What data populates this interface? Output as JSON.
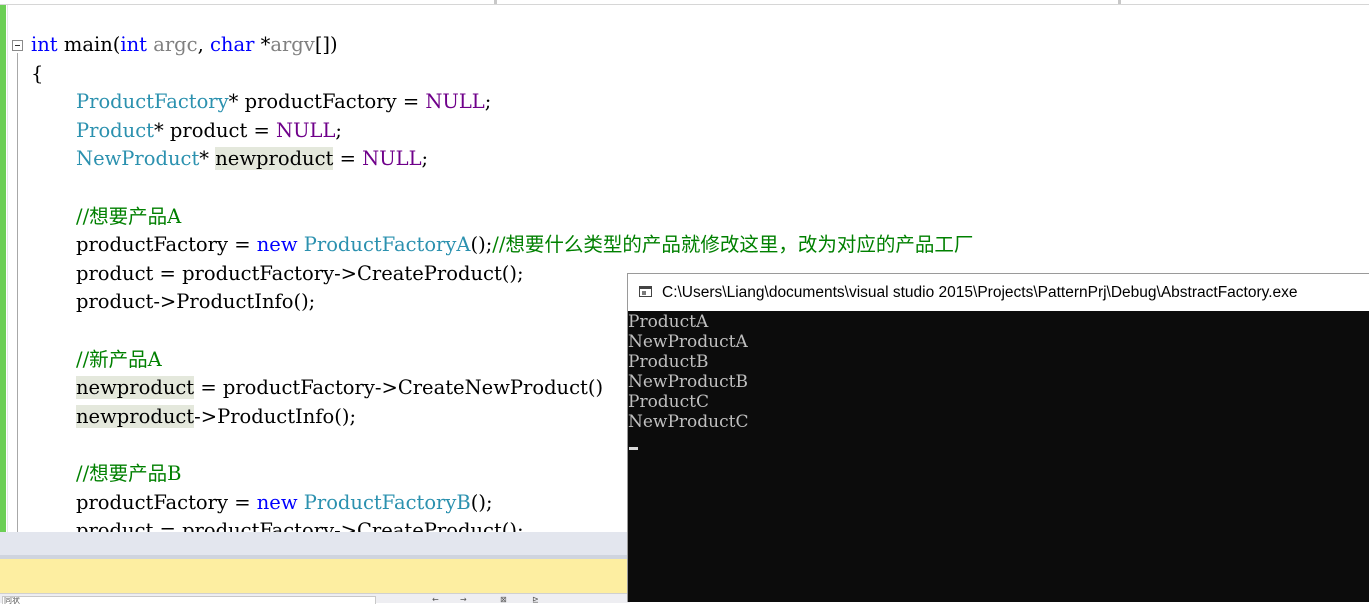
{
  "editor": {
    "lines": [
      [
        {
          "t": "int",
          "c": "kw"
        },
        {
          "t": " main(",
          "c": ""
        },
        {
          "t": "int",
          "c": "kw"
        },
        {
          "t": " ",
          "c": ""
        },
        {
          "t": "argc",
          "c": "param"
        },
        {
          "t": ", ",
          "c": ""
        },
        {
          "t": "char",
          "c": "kw"
        },
        {
          "t": " *",
          "c": ""
        },
        {
          "t": "argv",
          "c": "param"
        },
        {
          "t": "[])",
          "c": ""
        }
      ],
      [
        {
          "t": "{",
          "c": ""
        }
      ],
      [
        {
          "i": 1
        },
        {
          "t": "ProductFactory",
          "c": "type"
        },
        {
          "t": "* productFactory = ",
          "c": ""
        },
        {
          "t": "NULL",
          "c": "macro"
        },
        {
          "t": ";",
          "c": ""
        }
      ],
      [
        {
          "i": 1
        },
        {
          "t": "Product",
          "c": "type"
        },
        {
          "t": "* product = ",
          "c": ""
        },
        {
          "t": "NULL",
          "c": "macro"
        },
        {
          "t": ";",
          "c": ""
        }
      ],
      [
        {
          "i": 1
        },
        {
          "t": "NewProduct",
          "c": "type"
        },
        {
          "t": "* ",
          "c": ""
        },
        {
          "t": "newproduct",
          "c": "hl"
        },
        {
          "t": " = ",
          "c": ""
        },
        {
          "t": "NULL",
          "c": "macro"
        },
        {
          "t": ";",
          "c": ""
        }
      ],
      [],
      [
        {
          "i": 1
        },
        {
          "t": "//想要产品A",
          "c": "cmt"
        }
      ],
      [
        {
          "i": 1
        },
        {
          "t": "productFactory = ",
          "c": ""
        },
        {
          "t": "new",
          "c": "kw"
        },
        {
          "t": " ",
          "c": ""
        },
        {
          "t": "ProductFactoryA",
          "c": "type"
        },
        {
          "t": "();",
          "c": ""
        },
        {
          "t": "//想要什么类型的产品就修改这里，改为对应的产品工厂",
          "c": "cmt"
        }
      ],
      [
        {
          "i": 1
        },
        {
          "t": "product = productFactory->CreateProduct();",
          "c": ""
        }
      ],
      [
        {
          "i": 1
        },
        {
          "t": "product->ProductInfo();",
          "c": ""
        }
      ],
      [],
      [
        {
          "i": 1
        },
        {
          "t": "//新产品A",
          "c": "cmt"
        }
      ],
      [
        {
          "i": 1
        },
        {
          "t": "newproduct",
          "c": "hl"
        },
        {
          "t": " = productFactory->CreateNewProduct()",
          "c": ""
        }
      ],
      [
        {
          "i": 1
        },
        {
          "t": "newproduct",
          "c": "hl"
        },
        {
          "t": "->ProductInfo();",
          "c": ""
        }
      ],
      [],
      [
        {
          "i": 1
        },
        {
          "t": "//想要产品B",
          "c": "cmt"
        }
      ],
      [
        {
          "i": 1
        },
        {
          "t": "productFactory = ",
          "c": ""
        },
        {
          "t": "new",
          "c": "kw"
        },
        {
          "t": " ",
          "c": ""
        },
        {
          "t": "ProductFactoryB",
          "c": "type"
        },
        {
          "t": "();",
          "c": ""
        }
      ],
      [
        {
          "i": 1
        },
        {
          "t": "product = productFactory->CreateProduct();",
          "c": ""
        }
      ]
    ]
  },
  "console": {
    "title": "C:\\Users\\Liang\\documents\\visual studio 2015\\Projects\\PatternPrj\\Debug\\AbstractFactory.exe",
    "output": [
      "ProductA",
      "NewProductA",
      "ProductB",
      "NewProductB",
      "ProductC",
      "NewProductC"
    ]
  },
  "bottom_panel": {
    "toolbar_text": "同状",
    "toolbar_icons": [
      "←",
      "→",
      "⊠",
      "⊵"
    ]
  },
  "colors": {
    "change_bar": "#6ccf55",
    "keyword": "#0000ff",
    "type": "#2b91af",
    "macro": "#6f008a",
    "param": "#808080",
    "comment": "#008000",
    "highlight": "#e4e8dc",
    "console_bg": "#0c0c0c",
    "console_text": "#c0c0c0",
    "panel_yellow": "#fdeea1"
  }
}
